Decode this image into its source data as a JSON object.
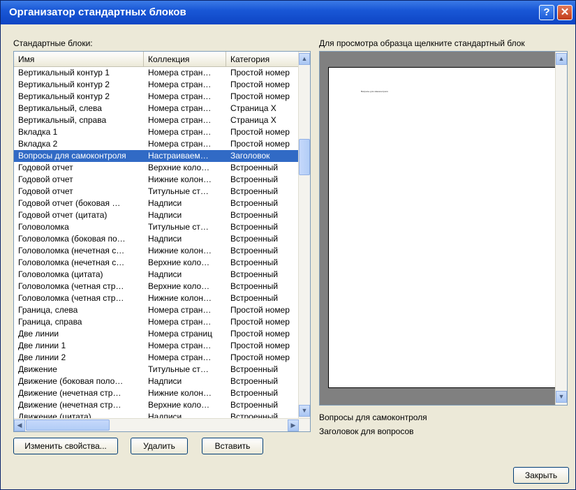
{
  "window": {
    "title": "Организатор стандартных блоков",
    "help_label": "?",
    "close_label": "✕"
  },
  "list_label": "Стандартные блоки:",
  "columns": [
    "Имя",
    "Коллекция",
    "Категория"
  ],
  "rows": [
    [
      "Вертикальный контур 1",
      "Номера стран…",
      "Простой номер"
    ],
    [
      "Вертикальный контур 2",
      "Номера стран…",
      "Простой номер"
    ],
    [
      "Вертикальный контур 2",
      "Номера стран…",
      "Простой номер"
    ],
    [
      "Вертикальный, слева",
      "Номера стран…",
      "Страница X"
    ],
    [
      "Вертикальный, справа",
      "Номера стран…",
      "Страница X"
    ],
    [
      "Вкладка 1",
      "Номера стран…",
      "Простой номер"
    ],
    [
      "Вкладка 2",
      "Номера стран…",
      "Простой номер"
    ],
    [
      "Вопросы для самоконтроля",
      "Настраиваем…",
      "Заголовок"
    ],
    [
      "Годовой отчет",
      "Верхние коло…",
      "Встроенный"
    ],
    [
      "Годовой отчет",
      "Нижние колон…",
      "Встроенный"
    ],
    [
      "Годовой отчет",
      "Титульные ст…",
      "Встроенный"
    ],
    [
      "Годовой отчет (боковая …",
      "Надписи",
      "Встроенный"
    ],
    [
      "Годовой отчет (цитата)",
      "Надписи",
      "Встроенный"
    ],
    [
      "Головоломка",
      "Титульные ст…",
      "Встроенный"
    ],
    [
      "Головоломка (боковая по…",
      "Надписи",
      "Встроенный"
    ],
    [
      "Головоломка (нечетная с…",
      "Нижние колон…",
      "Встроенный"
    ],
    [
      "Головоломка (нечетная с…",
      "Верхние коло…",
      "Встроенный"
    ],
    [
      "Головоломка (цитата)",
      "Надписи",
      "Встроенный"
    ],
    [
      "Головоломка (четная стр…",
      "Верхние коло…",
      "Встроенный"
    ],
    [
      "Головоломка (четная стр…",
      "Нижние колон…",
      "Встроенный"
    ],
    [
      "Граница, слева",
      "Номера стран…",
      "Простой номер"
    ],
    [
      "Граница, справа",
      "Номера стран…",
      "Простой номер"
    ],
    [
      "Две линии",
      "Номера страниц",
      "Простой номер"
    ],
    [
      "Две линии 1",
      "Номера стран…",
      "Простой номер"
    ],
    [
      "Две линии 2",
      "Номера стран…",
      "Простой номер"
    ],
    [
      "Движение",
      "Титульные ст…",
      "Встроенный"
    ],
    [
      "Движение (боковая поло…",
      "Надписи",
      "Встроенный"
    ],
    [
      "Движение (нечетная стр…",
      "Нижние колон…",
      "Встроенный"
    ],
    [
      "Движение (нечетная стр…",
      "Верхние коло…",
      "Встроенный"
    ],
    [
      "Движение (цитата)",
      "Надписи",
      "Встроенный"
    ]
  ],
  "selected_row": 7,
  "preview_hint": "Для просмотра образца щелкните стандартный блок",
  "preview_page_text": "Вопросы для самоконтроля",
  "selected_name": "Вопросы для самоконтроля",
  "selected_description": "Заголовок для вопросов",
  "buttons": {
    "edit": "Изменить свойства...",
    "delete": "Удалить",
    "insert": "Вставить",
    "close": "Закрыть"
  },
  "icons": {
    "scroll_up": "▲",
    "scroll_down": "▼",
    "scroll_left": "◀",
    "scroll_right": "▶",
    "sort_up": "▲"
  },
  "colors": {
    "titlebar": "#1957d6",
    "selection": "#316ac5",
    "dialog_bg": "#ece9d8"
  }
}
